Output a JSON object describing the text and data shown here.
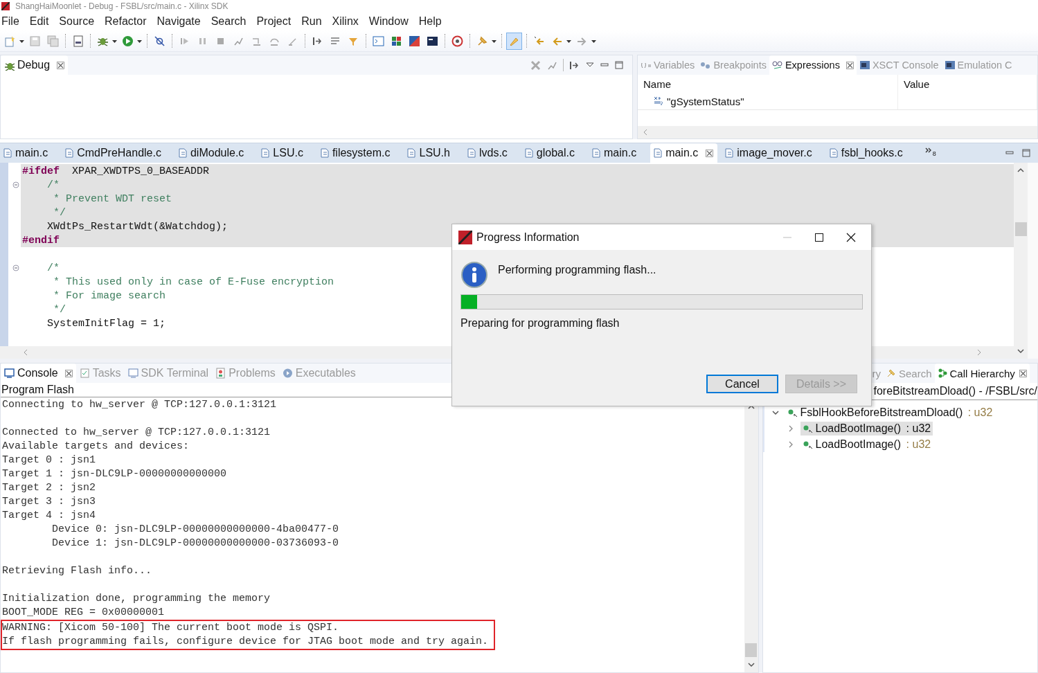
{
  "window": {
    "title": "ShangHaiMoonlet - Debug - FSBL/src/main.c - Xilinx SDK"
  },
  "menu": [
    "File",
    "Edit",
    "Source",
    "Refactor",
    "Navigate",
    "Search",
    "Project",
    "Run",
    "Xilinx",
    "Window",
    "Help"
  ],
  "toolbar": {
    "groups": [
      [
        {
          "pressed": false,
          "menu": true
        },
        {
          "pressed": false,
          "menu": false
        },
        {
          "pressed": false,
          "menu": false
        }
      ],
      [
        {
          "pressed": false,
          "menu": false
        }
      ],
      [
        {
          "pressed": false,
          "menu": true
        },
        {
          "pressed": false,
          "menu": true
        }
      ],
      [
        {
          "pressed": false,
          "menu": false
        }
      ],
      [
        {
          "pressed": false,
          "menu": false
        },
        {
          "pressed": false,
          "menu": false
        },
        {
          "pressed": false,
          "menu": false
        },
        {
          "pressed": false,
          "menu": false
        },
        {
          "pressed": false,
          "menu": false
        },
        {
          "pressed": false,
          "menu": false
        },
        {
          "pressed": false,
          "menu": false
        }
      ],
      [
        {
          "pressed": false,
          "menu": false
        },
        {
          "pressed": false,
          "menu": false
        },
        {
          "pressed": false,
          "menu": false
        }
      ],
      [
        {
          "pressed": false,
          "menu": false
        },
        {
          "pressed": false,
          "menu": false
        },
        {
          "pressed": false,
          "menu": false
        },
        {
          "pressed": false,
          "menu": false
        }
      ],
      [
        {
          "pressed": false,
          "menu": false
        }
      ],
      [
        {
          "pressed": false,
          "menu": true
        }
      ],
      [
        {
          "pressed": true,
          "menu": false
        }
      ],
      [
        {
          "pressed": false,
          "menu": false
        },
        {
          "pressed": false,
          "menu": true
        },
        {
          "pressed": false,
          "menu": true
        }
      ]
    ]
  },
  "debug_view": {
    "tabs": [
      {
        "label": "Debug",
        "selected": true
      }
    ]
  },
  "expressions_view": {
    "tabs": [
      {
        "label": "Variables",
        "selected": false
      },
      {
        "label": "Breakpoints",
        "selected": false
      },
      {
        "label": "Expressions",
        "selected": true
      },
      {
        "label": "XSCT Console",
        "selected": false
      },
      {
        "label": "Emulation C",
        "selected": false
      }
    ],
    "columns": [
      "Name",
      "Value"
    ],
    "rows": [
      {
        "name": "\"gSystemStatus\""
      }
    ]
  },
  "editor": {
    "tabs": [
      {
        "label": "main.c",
        "selected": false
      },
      {
        "label": "CmdPreHandle.c",
        "selected": false
      },
      {
        "label": "diModule.c",
        "selected": false
      },
      {
        "label": "LSU.c",
        "selected": false
      },
      {
        "label": "filesystem.c",
        "selected": false
      },
      {
        "label": "LSU.h",
        "selected": false
      },
      {
        "label": "lvds.c",
        "selected": false
      },
      {
        "label": "global.c",
        "selected": false
      },
      {
        "label": "main.c",
        "selected": false
      },
      {
        "label": "main.c",
        "selected": true
      },
      {
        "label": "image_mover.c",
        "selected": false
      },
      {
        "label": "fsbl_hooks.c",
        "selected": false
      }
    ],
    "hidden_tab_count": "8",
    "lines": [
      {
        "kind": "directive",
        "text": "#ifdef",
        "rest": "  XPAR_XWDTPS_0_BASEADDR",
        "shaded": true,
        "fold": false
      },
      {
        "kind": "comment",
        "text": "    /*",
        "shaded": true,
        "fold": true
      },
      {
        "kind": "comment",
        "text": "     * Prevent WDT reset",
        "shaded": true,
        "fold": false
      },
      {
        "kind": "comment",
        "text": "     */",
        "shaded": true,
        "fold": false
      },
      {
        "kind": "code",
        "text": "    XWdtPs_RestartWdt(&Watchdog);",
        "shaded": true,
        "fold": false
      },
      {
        "kind": "directive",
        "text": "#endif",
        "shaded": true,
        "fold": false
      },
      {
        "kind": "blank",
        "shaded": false,
        "fold": false
      },
      {
        "kind": "comment",
        "text": "    /*",
        "shaded": false,
        "fold": true
      },
      {
        "kind": "comment",
        "text": "     * This used only in case of E-Fuse encryption",
        "shaded": false,
        "fold": false
      },
      {
        "kind": "comment",
        "text": "     * For image search",
        "shaded": false,
        "fold": false
      },
      {
        "kind": "comment",
        "text": "     */",
        "shaded": false,
        "fold": false
      },
      {
        "kind": "code",
        "text": "    SystemInitFlag = 1;",
        "shaded": false,
        "fold": false
      }
    ]
  },
  "console_view": {
    "tabs": [
      {
        "label": "Console",
        "selected": true
      },
      {
        "label": "Tasks",
        "selected": false
      },
      {
        "label": "SDK Terminal",
        "selected": false
      },
      {
        "label": "Problems",
        "selected": false
      },
      {
        "label": "Executables",
        "selected": false
      }
    ],
    "title": "Program Flash",
    "lines": [
      {
        "text": "Connecting to hw_server @ TCP:127.0.0.1:3121",
        "boxed": false
      },
      {
        "boxed": false
      },
      {
        "text": "Connected to hw_server @ TCP:127.0.0.1:3121",
        "boxed": false
      },
      {
        "text": "Available targets and devices:",
        "boxed": false
      },
      {
        "text": "Target 0 : jsn1",
        "boxed": false
      },
      {
        "text": "Target 1 : jsn-DLC9LP-00000000000000",
        "boxed": false
      },
      {
        "text": "Target 2 : jsn2",
        "boxed": false
      },
      {
        "text": "Target 3 : jsn3",
        "boxed": false
      },
      {
        "text": "Target 4 : jsn4",
        "boxed": false
      },
      {
        "text": "        Device 0: jsn-DLC9LP-00000000000000-4ba00477-0",
        "boxed": false
      },
      {
        "text": "        Device 1: jsn-DLC9LP-00000000000000-03736093-0",
        "boxed": false
      },
      {
        "boxed": false
      },
      {
        "text": "Retrieving Flash info...",
        "boxed": false
      },
      {
        "boxed": false
      },
      {
        "text": "Initialization done, programming the memory",
        "boxed": false
      },
      {
        "text": "BOOT_MODE REG = 0x00000001",
        "boxed": false
      },
      {
        "text": "WARNING: [Xicom 50-100] The current boot mode is QSPI.",
        "boxed": true
      },
      {
        "text": "If flash programming fails, configure device for JTAG boot mode and try again.",
        "boxed": true
      }
    ]
  },
  "call_hierarchy_view": {
    "tabs": [
      {
        "label": "ry",
        "selected": false
      },
      {
        "label": "Search",
        "selected": false
      },
      {
        "label": "Call Hierarchy",
        "selected": true
      }
    ],
    "header": "foreBitstreamDload() - /FSBL/src/",
    "tree": [
      {
        "name": "FsblHookBeforeBitstreamDload()",
        "type": " : u32",
        "expanded": true,
        "selected": false,
        "children": [
          {
            "name": "LoadBootImage()",
            "type": " : u32",
            "expanded": false,
            "selected": true
          },
          {
            "name": "LoadBootImage()",
            "type": " : u32",
            "expanded": false,
            "selected": false
          }
        ]
      }
    ]
  },
  "dialog": {
    "title": "Progress Information",
    "message": "Performing programming flash...",
    "progress": {
      "level": 0.04
    },
    "subtask": "Preparing for programming flash",
    "buttons": [
      {
        "label": "Cancel",
        "default": true,
        "disabled": false
      },
      {
        "label": "Details >>",
        "default": false,
        "disabled": true
      }
    ]
  }
}
